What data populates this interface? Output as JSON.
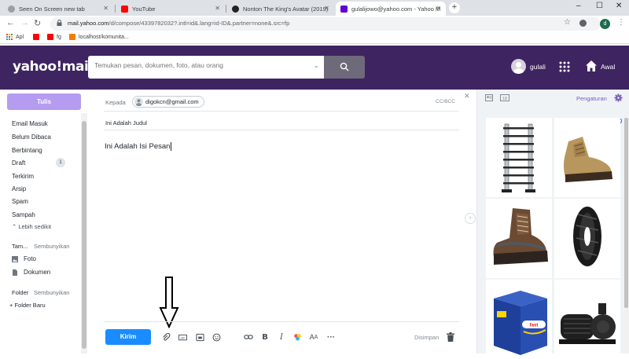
{
  "browser": {
    "tabs": [
      {
        "title": "Seen On Screen new tab",
        "active": false
      },
      {
        "title": "YouTube",
        "active": false
      },
      {
        "title": "Nonton The King's Avatar (2019)",
        "active": false
      },
      {
        "title": "gulalijowo@yahoo.com - Yahoo M",
        "active": true
      }
    ],
    "url_host": "mail.yahoo.com",
    "url_path": "/d/compose/4339782032?.intl=id&.lang=id-ID&.partner=none&.src=fp",
    "profile_initial": "d",
    "bookmarks": [
      "Apl",
      "",
      "fg",
      "localhost/komunita..."
    ]
  },
  "header": {
    "logo": "yahoo!mail",
    "search_placeholder": "Temukan pesan, dokumen, foto, atau orang",
    "username": "gulali",
    "home_label": "Awal"
  },
  "sidebar": {
    "compose_label": "Tulis",
    "folders": [
      {
        "label": "Email Masuk"
      },
      {
        "label": "Belum Dibaca"
      },
      {
        "label": "Berbintang"
      },
      {
        "label": "Draft",
        "count": "1"
      },
      {
        "label": "Terkirim"
      },
      {
        "label": "Arsip"
      },
      {
        "label": "Spam"
      },
      {
        "label": "Sampah"
      }
    ],
    "less_label": "Lebih sedikit",
    "views_head": "Tam...",
    "views_hide": "Sembunyikan",
    "views": [
      {
        "label": "Foto"
      },
      {
        "label": "Dokumen"
      }
    ],
    "folder_head": "Folder",
    "folder_hide": "Sembunyikan",
    "new_folder": "Folder Baru"
  },
  "compose": {
    "to_label": "Kepada",
    "recipient": "digokcn@gmail.com",
    "cc_label": "CC/BCC",
    "subject": "Ini Adalah Judul",
    "body": "Ini Adalah Isi Pesan",
    "send_label": "Kirim",
    "saved_label": "Disimpan"
  },
  "right_panel": {
    "settings_label": "Pengaturan",
    "ads": [
      "ladder",
      "work-boot-tan",
      "hiking-boot-brown",
      "motorcycle-tire",
      "paper-ream-box",
      "water-pump"
    ]
  },
  "colors": {
    "yahoo_purple": "#3e2460",
    "compose_button": "#b59cf0",
    "send_button": "#1a8cff",
    "settings_text": "#7759c2"
  }
}
